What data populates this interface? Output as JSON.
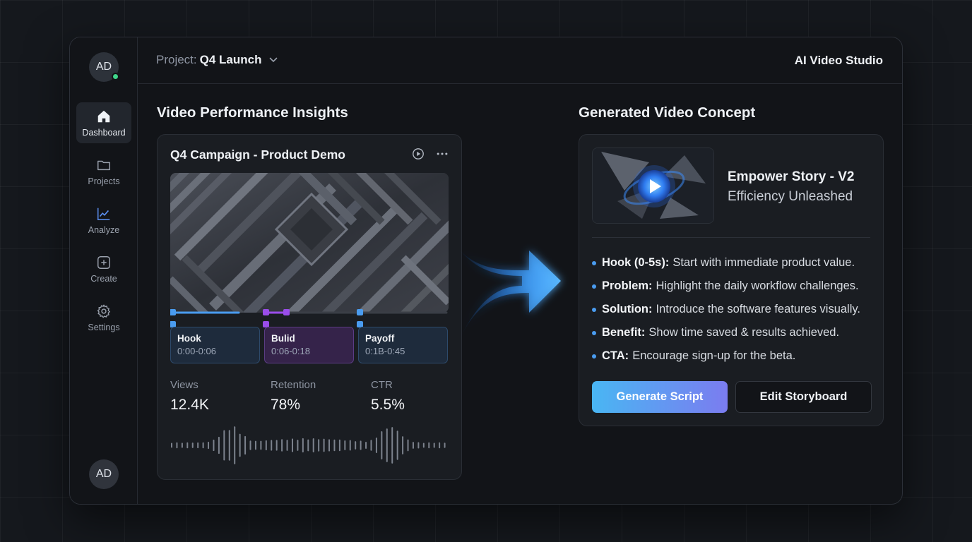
{
  "user": {
    "initials": "AD"
  },
  "sidebar": {
    "items": [
      {
        "label": "Dashboard",
        "icon": "home-icon"
      },
      {
        "label": "Projects",
        "icon": "folder-icon"
      },
      {
        "label": "Analyze",
        "icon": "chart-line-icon"
      },
      {
        "label": "Create",
        "icon": "plus-square-icon"
      },
      {
        "label": "Settings",
        "icon": "gear-icon"
      }
    ]
  },
  "header": {
    "project_prefix": "Project:",
    "project_name": "Q4 Launch",
    "app_title": "AI Video Studio"
  },
  "insights": {
    "section_title": "Video Performance Insights",
    "card_title": "Q4 Campaign - Product Demo",
    "segments": [
      {
        "label": "Hook",
        "time": "0:00-0:06"
      },
      {
        "label": "Bulid",
        "time": "0:06-0:18"
      },
      {
        "label": "Payoff",
        "time": "0:1B-0:45"
      }
    ],
    "metrics": [
      {
        "label": "Views",
        "value": "12.4K"
      },
      {
        "label": "Retention",
        "value": "78%"
      },
      {
        "label": "CTR",
        "value": "5.5%"
      }
    ]
  },
  "concept": {
    "section_title": "Generated Video Concept",
    "name": "Empower Story - V2",
    "subtitle": "Efficiency Unleashed",
    "bullets": [
      {
        "key": "Hook (0-5s):",
        "text": "Start with immediate product value."
      },
      {
        "key": "Problem:",
        "text": "Highlight the daily workflow challenges."
      },
      {
        "key": "Solution:",
        "text": "Introduce the software features visually."
      },
      {
        "key": "Benefit:",
        "text": "Show time saved & results achieved."
      },
      {
        "key": "CTA:",
        "text": "Encourage sign-up for the beta."
      }
    ],
    "primary_button": "Generate Script",
    "secondary_button": "Edit Storyboard"
  },
  "colors": {
    "accent_blue": "#4a9cf0",
    "accent_purple": "#9a4dea",
    "status_online": "#3fd58a"
  }
}
